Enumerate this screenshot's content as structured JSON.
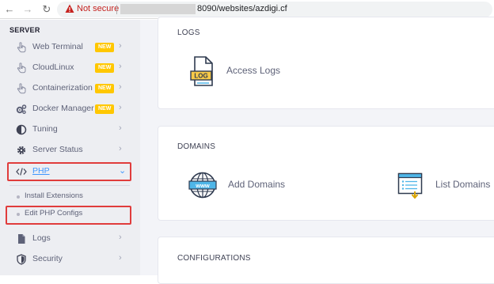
{
  "browser": {
    "security_label": "Not secure",
    "url": "8090/websites/azdigi.cf"
  },
  "sidebar": {
    "section_title": "SERVER",
    "items": [
      {
        "label": "Web Terminal",
        "badge": "NEW",
        "icon": "hand-pointer-icon"
      },
      {
        "label": "CloudLinux",
        "badge": "NEW",
        "icon": "hand-pointer-icon"
      },
      {
        "label": "Containerization",
        "badge": "NEW",
        "icon": "hand-pointer-icon"
      },
      {
        "label": "Docker Manager",
        "badge": "NEW",
        "icon": "cogs-icon"
      },
      {
        "label": "Tuning",
        "icon": "half-circle-icon"
      },
      {
        "label": "Server Status",
        "icon": "gear-icon"
      },
      {
        "label": "PHP",
        "icon": "code-icon",
        "active": true
      },
      {
        "label": "Logs",
        "icon": "file-icon"
      },
      {
        "label": "Security",
        "icon": "shield-icon"
      }
    ],
    "php_subitems": [
      {
        "label": "Install Extensions"
      },
      {
        "label": "Edit PHP Configs"
      }
    ]
  },
  "main": {
    "logs": {
      "title": "LOGS",
      "tiles": [
        {
          "label": "Access Logs",
          "icon": "log-file-icon"
        }
      ]
    },
    "domains": {
      "title": "DOMAINS",
      "tiles": [
        {
          "label": "Add Domains",
          "icon": "www-globe-icon"
        },
        {
          "label": "List Domains",
          "icon": "list-window-icon"
        }
      ]
    },
    "configurations": {
      "title": "CONFIGURATIONS"
    }
  },
  "colors": {
    "accent": "#3e97ff",
    "badge": "#ffc700",
    "highlight": "#e03c3c",
    "sidebar_bg": "#edeef2",
    "not_secure": "#c5221f"
  }
}
